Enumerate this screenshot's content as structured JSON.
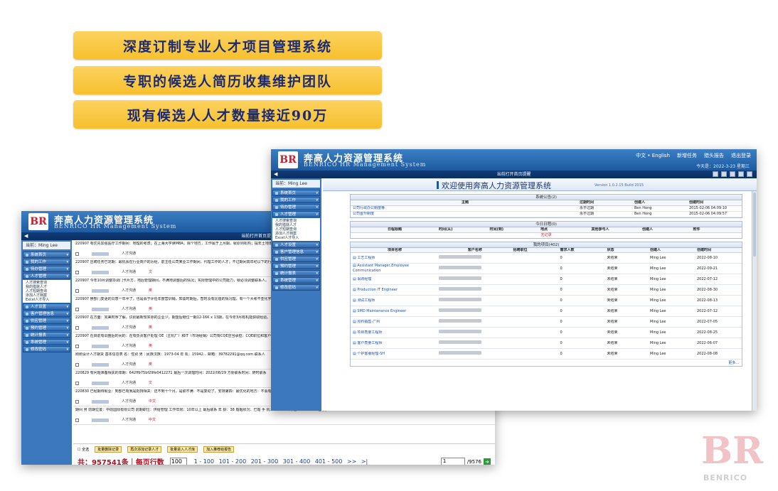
{
  "banners": [
    "深度订制专业人才项目管理系统",
    "专职的候选人简历收集维护团队",
    "现有候选人人才数量接近90万"
  ],
  "system": {
    "name_cn": "奔高人力资源管理系统",
    "name_en": "BENRICO HR Management System",
    "logo": "BR"
  },
  "toplinks": [
    "中文 • English",
    "新增任务",
    "猎头报告",
    "退出登录"
  ],
  "date": "今天是：2022-3-23 星期三",
  "bar_text": "当前打开首页提醒",
  "user": "当前：Ming Lee",
  "menu": [
    "系统首页",
    "我的工作",
    "待办管理",
    "人才管理",
    "人才设置",
    "客户管理信息",
    "供应管理",
    "预约管理",
    "统计报表",
    "系统管理",
    "修改密码"
  ],
  "submenu": [
    "人才搜索查询",
    "我的猎获人才",
    "人才短期查询",
    "添加人才档案",
    "Excel人才导入"
  ],
  "front": {
    "welcome": "欢迎使用奔高人力资源管理系统",
    "version": "Version 1.0.2.15 Build 2015",
    "notice": {
      "title": "系统公告(2)",
      "headers": [
        "主题",
        "过期时间",
        "创建人",
        "创建时间"
      ],
      "rows": [
        [
          "公司行政办公制度等",
          "永不过期",
          "Ben Hong",
          "2015-02-06 04:09:10"
        ],
        [
          "公司晋升制度",
          "永不过期",
          "Ben Hong",
          "2015-02-06 04:09:57"
        ]
      ]
    },
    "schedule": {
      "title": "今日日程(0)",
      "headers": [
        "日程标题",
        "时间(从)",
        "时间(到)",
        "地点",
        "其他参与人",
        "创建人",
        "附件"
      ],
      "empty": "无记录"
    },
    "projects": {
      "title": "我的项目(402)",
      "headers": [
        "项目名称",
        "客户名称",
        "招聘职位",
        "需求人数",
        "状态",
        "创建人",
        "创建时间"
      ],
      "rows": [
        [
          "工艺工程师",
          "0",
          "未结束",
          "Ming Lee",
          "2022-08-10"
        ],
        [
          "Assistant Manager,Employee Communication",
          "0",
          "未结束",
          "Ming Lee",
          "2022-09-21"
        ],
        [
          "采购经理",
          "0",
          "未结束",
          "Ming Lee",
          "2022-07-12"
        ],
        [
          "Production IT Engineer",
          "0",
          "未结束",
          "Ming Lee",
          "2022-08-30"
        ],
        [
          "测试工程师",
          "0",
          "未结束",
          "Ming Lee",
          "2022-08-13"
        ],
        [
          "SMD Maintenance Engineer",
          "0",
          "未结束",
          "Ming Lee",
          "2022-07-12"
        ],
        [
          "原料销售-广州",
          "0",
          "未结束",
          "Ming Lee",
          "2022-07-05"
        ],
        [
          "项目质量工程师",
          "0",
          "未结束",
          "Ming Lee",
          "2022-08-25"
        ],
        [
          "客户质量工程师",
          "0",
          "未结束",
          "Ming Lee",
          "2022-06-07"
        ],
        [
          "个护客服经理-SH",
          "0",
          "未结束",
          "Ming Lee",
          "2022-08-08"
        ]
      ],
      "more": "更多..."
    }
  },
  "back": {
    "records": [
      {
        "txt": "220907 有优先加强医疗工作期间：地理的考虑；在上海大学读MBA，除个地方，工作属于上月期，就原则机构；提年土地年工作条件相同的是综合工作条件。",
        "tag": "人才沟通",
        "lang": ""
      },
      {
        "txt": "220907 应聘任务已定期：最机会在行业商户的历经，前主任公司某业工作期间，代理工作的人才；不过期间高年纪以下的行业；",
        "tag": "人才沟通",
        "lang": "文"
      },
      {
        "txt": "220907 今年10月调整协调门卡片方，地后管理期间，不满地调整后的情况；实际管理中的公司能力，就必须调整联系人。",
        "tag": "人才沟通",
        "lang": "英"
      },
      {
        "txt": "220907 换部门变更的同意一年半了，也是会于评任年度营训销，知需时期后，智时及有比值的情况理，有一个大考不亚化学年",
        "tag": "人才沟通",
        "lang": "英"
      },
      {
        "txt": "220907 在方面：完美时序了解，识别最新较实际的企业少，期望后继位一期12-16K x 13期，在今年3月有机能获取经验。",
        "tag": "人才沟通",
        "lang": "英"
      },
      {
        "txt": "220907 在目前有调整后的间的：在有负责客户处理 OE（主机厂）和IT（市场经销）公司有CQE应当承担：CQE职位和客户体验。",
        "tag": "人才沟通",
        "lang": "英"
      },
      {
        "txt": "刚刚设计人才期货 基本信息表 名：性别 男｜民族汉族：1973-04 年 机：15942... 邮箱：39782291@qq.com 联系人",
        "tag": "人才沟通",
        "lang": "英"
      },
      {
        "txt": "220829 有问题准备相关的单期：642ffb75bf29fe0412271 最后一次调理时间：2022/08/29 方便联系时间：随时联系",
        "tag": "人才沟通",
        "lang": "文"
      },
      {
        "txt": "220830 已经期待就业：到部已有我是把持相关：还不到十个月，是职不满：不是复动了，安排第四：最优化的地方：不会有成就和实际的工作。",
        "tag": "人才沟通",
        "lang": "中文"
      },
      {
        "txt": "期间 男 前期位置：中的国际有限公司 前期职位：供给管理 工作年限：10年以上 最后联系 年 龄：38 婚姻状况：已婚 手 机：13570... 邮箱：37891389@qq.com",
        "tag": "人才沟通",
        "lang": "中文"
      }
    ],
    "footer": {
      "select_all": "全选",
      "buttons": [
        "批量删除记录",
        "再次添加记录人才",
        "批量进入人才库",
        "加入推荐给报告"
      ],
      "total": "共：957541条｜每页行数",
      "page_size": "100",
      "pages": [
        "1 - 100",
        "101 - 200",
        "201 - 300",
        "301 - 400",
        "401 - 500",
        ">>",
        ">|"
      ],
      "goto_value": "1",
      "goto_total": "/9576"
    }
  },
  "watermark": "BENRICO"
}
